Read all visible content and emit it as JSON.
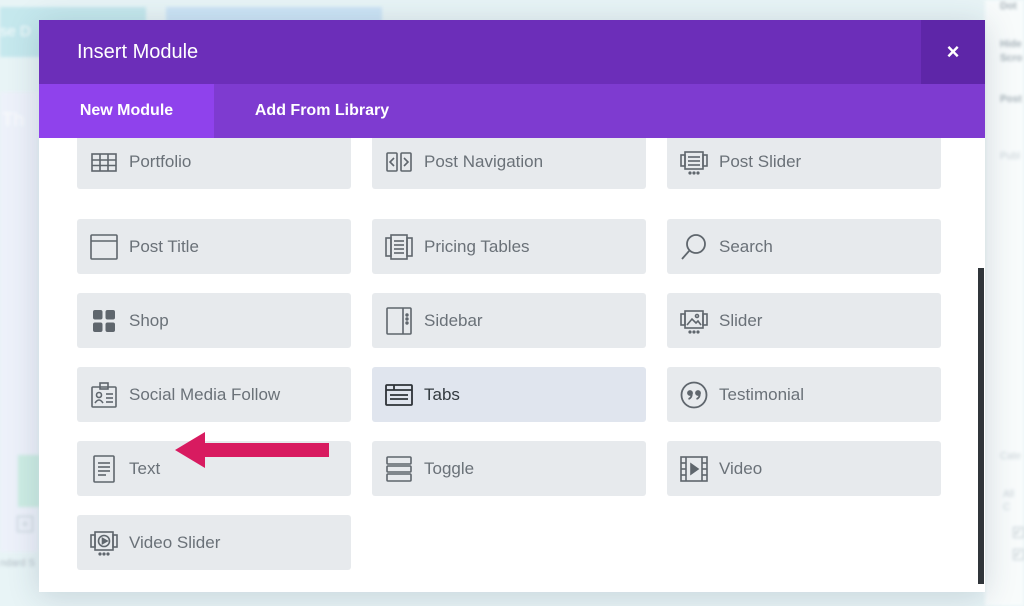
{
  "background": {
    "tab_a_text": "se D",
    "panel_text": "Th",
    "left_bottom_text": "ndard S",
    "right_panel": {
      "labels": [
        "Dot",
        "Hide",
        "Scro",
        "Post"
      ],
      "light_labels": [
        "Publ",
        "Cate",
        "All C"
      ]
    }
  },
  "modal": {
    "title": "Insert Module",
    "close_symbol": "×",
    "tabs": [
      {
        "label": "New Module",
        "active": true
      },
      {
        "label": "Add From Library",
        "active": false
      }
    ],
    "modules": [
      {
        "label": "Portfolio",
        "icon": "portfolio-grid-icon"
      },
      {
        "label": "Post Navigation",
        "icon": "post-navigation-icon"
      },
      {
        "label": "Post Slider",
        "icon": "post-slider-icon"
      },
      {
        "label": "Post Title",
        "icon": "post-title-icon"
      },
      {
        "label": "Pricing Tables",
        "icon": "pricing-tables-icon"
      },
      {
        "label": "Search",
        "icon": "search-icon"
      },
      {
        "label": "Shop",
        "icon": "shop-icon"
      },
      {
        "label": "Sidebar",
        "icon": "sidebar-icon"
      },
      {
        "label": "Slider",
        "icon": "slider-icon"
      },
      {
        "label": "Social Media Follow",
        "icon": "social-follow-icon"
      },
      {
        "label": "Tabs",
        "icon": "tabs-icon"
      },
      {
        "label": "Testimonial",
        "icon": "testimonial-quote-icon"
      },
      {
        "label": "Text",
        "icon": "text-document-icon"
      },
      {
        "label": "Toggle",
        "icon": "toggle-icon"
      },
      {
        "label": "Video",
        "icon": "video-film-icon"
      },
      {
        "label": "Video Slider",
        "icon": "video-slider-icon"
      }
    ],
    "hovered_module": "Tabs"
  },
  "colors": {
    "header": "#6c2eb9",
    "tabbar": "#7e3bd0",
    "active_tab": "#8f42ec",
    "arrow": "#d81b60",
    "module_bg": "#e7eaed"
  }
}
